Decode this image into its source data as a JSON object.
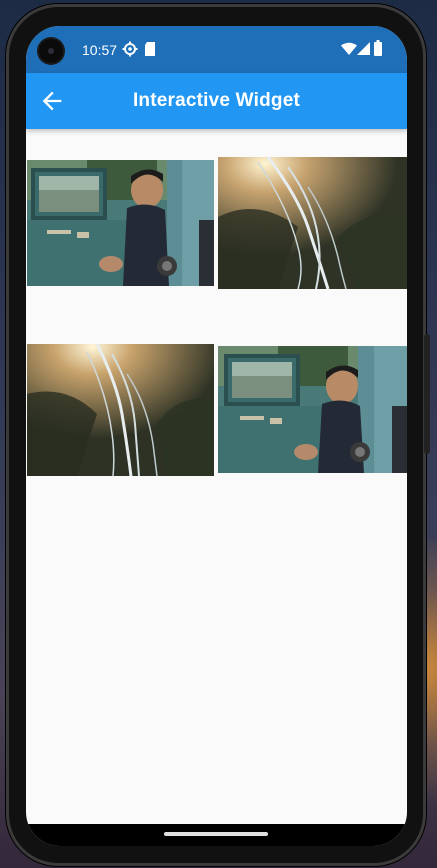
{
  "status_bar": {
    "time": "10:57",
    "left_icons": [
      "settings-gear-icon",
      "sd-card-icon"
    ],
    "right_icons": [
      "wifi-icon",
      "cellular-signal-icon",
      "battery-icon"
    ],
    "color": "#1e6fb8"
  },
  "app_bar": {
    "title": "Interactive Widget",
    "back_icon": "arrow-back-icon",
    "color": "#2196f3"
  },
  "gallery": {
    "images": [
      {
        "subject": "man leaning out of vintage teal truck door"
      },
      {
        "subject": "aerial view of braided river at sunrise"
      },
      {
        "subject": "aerial view of braided river at sunrise"
      },
      {
        "subject": "man leaning out of vintage teal truck door"
      }
    ]
  }
}
